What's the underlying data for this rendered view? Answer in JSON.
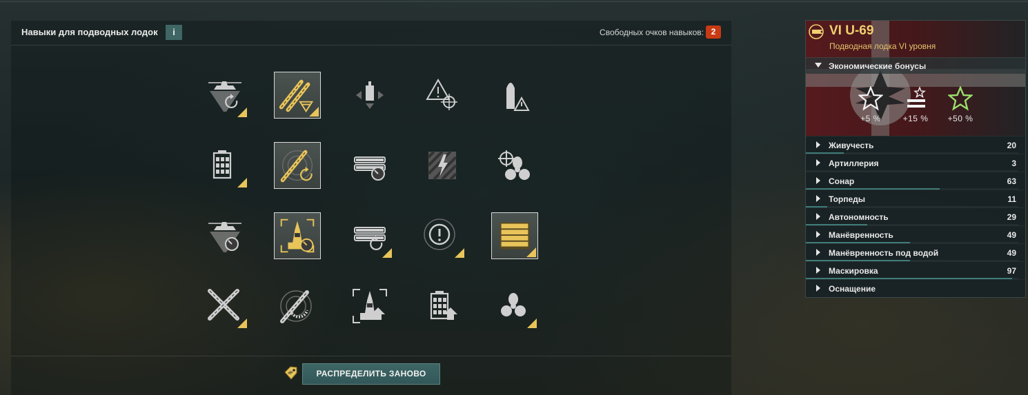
{
  "skills_panel": {
    "title": "Навыки для подводных лодок",
    "info_label": "i",
    "free_points_label": "Свободных очков навыков:",
    "free_points_value": "2",
    "reset_button_label": "РАСПРЕДЕЛИТЬ ЗАНОВО"
  },
  "skills": [
    [
      {
        "icon": "submarine-sonar-reload-icon",
        "selected": false,
        "corner": true
      },
      {
        "icon": "torpedo-acceleration-icon",
        "selected": true,
        "corner": true
      },
      {
        "icon": "sonar-direction-icon",
        "selected": false,
        "corner": false
      },
      {
        "icon": "warning-target-icon",
        "selected": false,
        "corner": false
      },
      {
        "icon": "shell-warning-icon",
        "selected": false,
        "corner": false
      }
    ],
    [
      {
        "icon": "battery-capacity-icon",
        "selected": false,
        "corner": true
      },
      {
        "icon": "torpedo-reload-icon",
        "selected": true,
        "corner": false
      },
      {
        "icon": "torpedo-tubes-timer-icon",
        "selected": false,
        "corner": false
      },
      {
        "icon": "lightning-icon",
        "selected": false,
        "corner": false
      },
      {
        "icon": "helm-propeller-icon",
        "selected": false,
        "corner": false
      }
    ],
    [
      {
        "icon": "submarine-sonar-timer-icon",
        "selected": false,
        "corner": false
      },
      {
        "icon": "ship-detection-timer-icon",
        "selected": true,
        "corner": false
      },
      {
        "icon": "torpedo-tubes-reload-icon",
        "selected": false,
        "corner": true
      },
      {
        "icon": "alert-radar-icon",
        "selected": false,
        "corner": true
      },
      {
        "icon": "torpedo-tubes-gold-icon",
        "selected": true,
        "corner": true
      }
    ],
    [
      {
        "icon": "crossed-torpedoes-icon",
        "selected": false,
        "corner": true
      },
      {
        "icon": "torpedo-radar-damage-icon",
        "selected": false,
        "corner": false
      },
      {
        "icon": "ship-detection-upgrade-icon",
        "selected": false,
        "corner": false
      },
      {
        "icon": "battery-upgrade-icon",
        "selected": false,
        "corner": false
      },
      {
        "icon": "propeller-icon",
        "selected": false,
        "corner": true
      }
    ]
  ],
  "ship": {
    "tier_name": "VI U-69",
    "class_label": "Подводная лодка VI уровня",
    "economic_header": "Экономические бонусы",
    "bonuses": [
      {
        "icon": "star-outline-icon",
        "value": "+5 %"
      },
      {
        "icon": "star-stripes-icon",
        "value": "+15 %"
      },
      {
        "icon": "star-green-icon",
        "value": "+50 %"
      }
    ],
    "stats": [
      {
        "label": "Живучесть",
        "value": "20",
        "fraction": 0.18
      },
      {
        "label": "Артиллерия",
        "value": "3",
        "fraction": 0.0
      },
      {
        "label": "Сонар",
        "value": "63",
        "fraction": 0.63
      },
      {
        "label": "Торпеды",
        "value": "11",
        "fraction": 0.1
      },
      {
        "label": "Автономность",
        "value": "29",
        "fraction": 0.29
      },
      {
        "label": "Манёвренность",
        "value": "49",
        "fraction": 0.49
      },
      {
        "label": "Манёвренность под водой",
        "value": "49",
        "fraction": 0.49
      },
      {
        "label": "Маскировка",
        "value": "97",
        "fraction": 0.97
      },
      {
        "label": "Оснащение",
        "value": "",
        "fraction": 0.0
      }
    ]
  },
  "colors": {
    "accent_teal": "#3f6664",
    "badge_red": "#c73a14",
    "gold": "#e8c45a",
    "ship_title": "#f0d070"
  }
}
